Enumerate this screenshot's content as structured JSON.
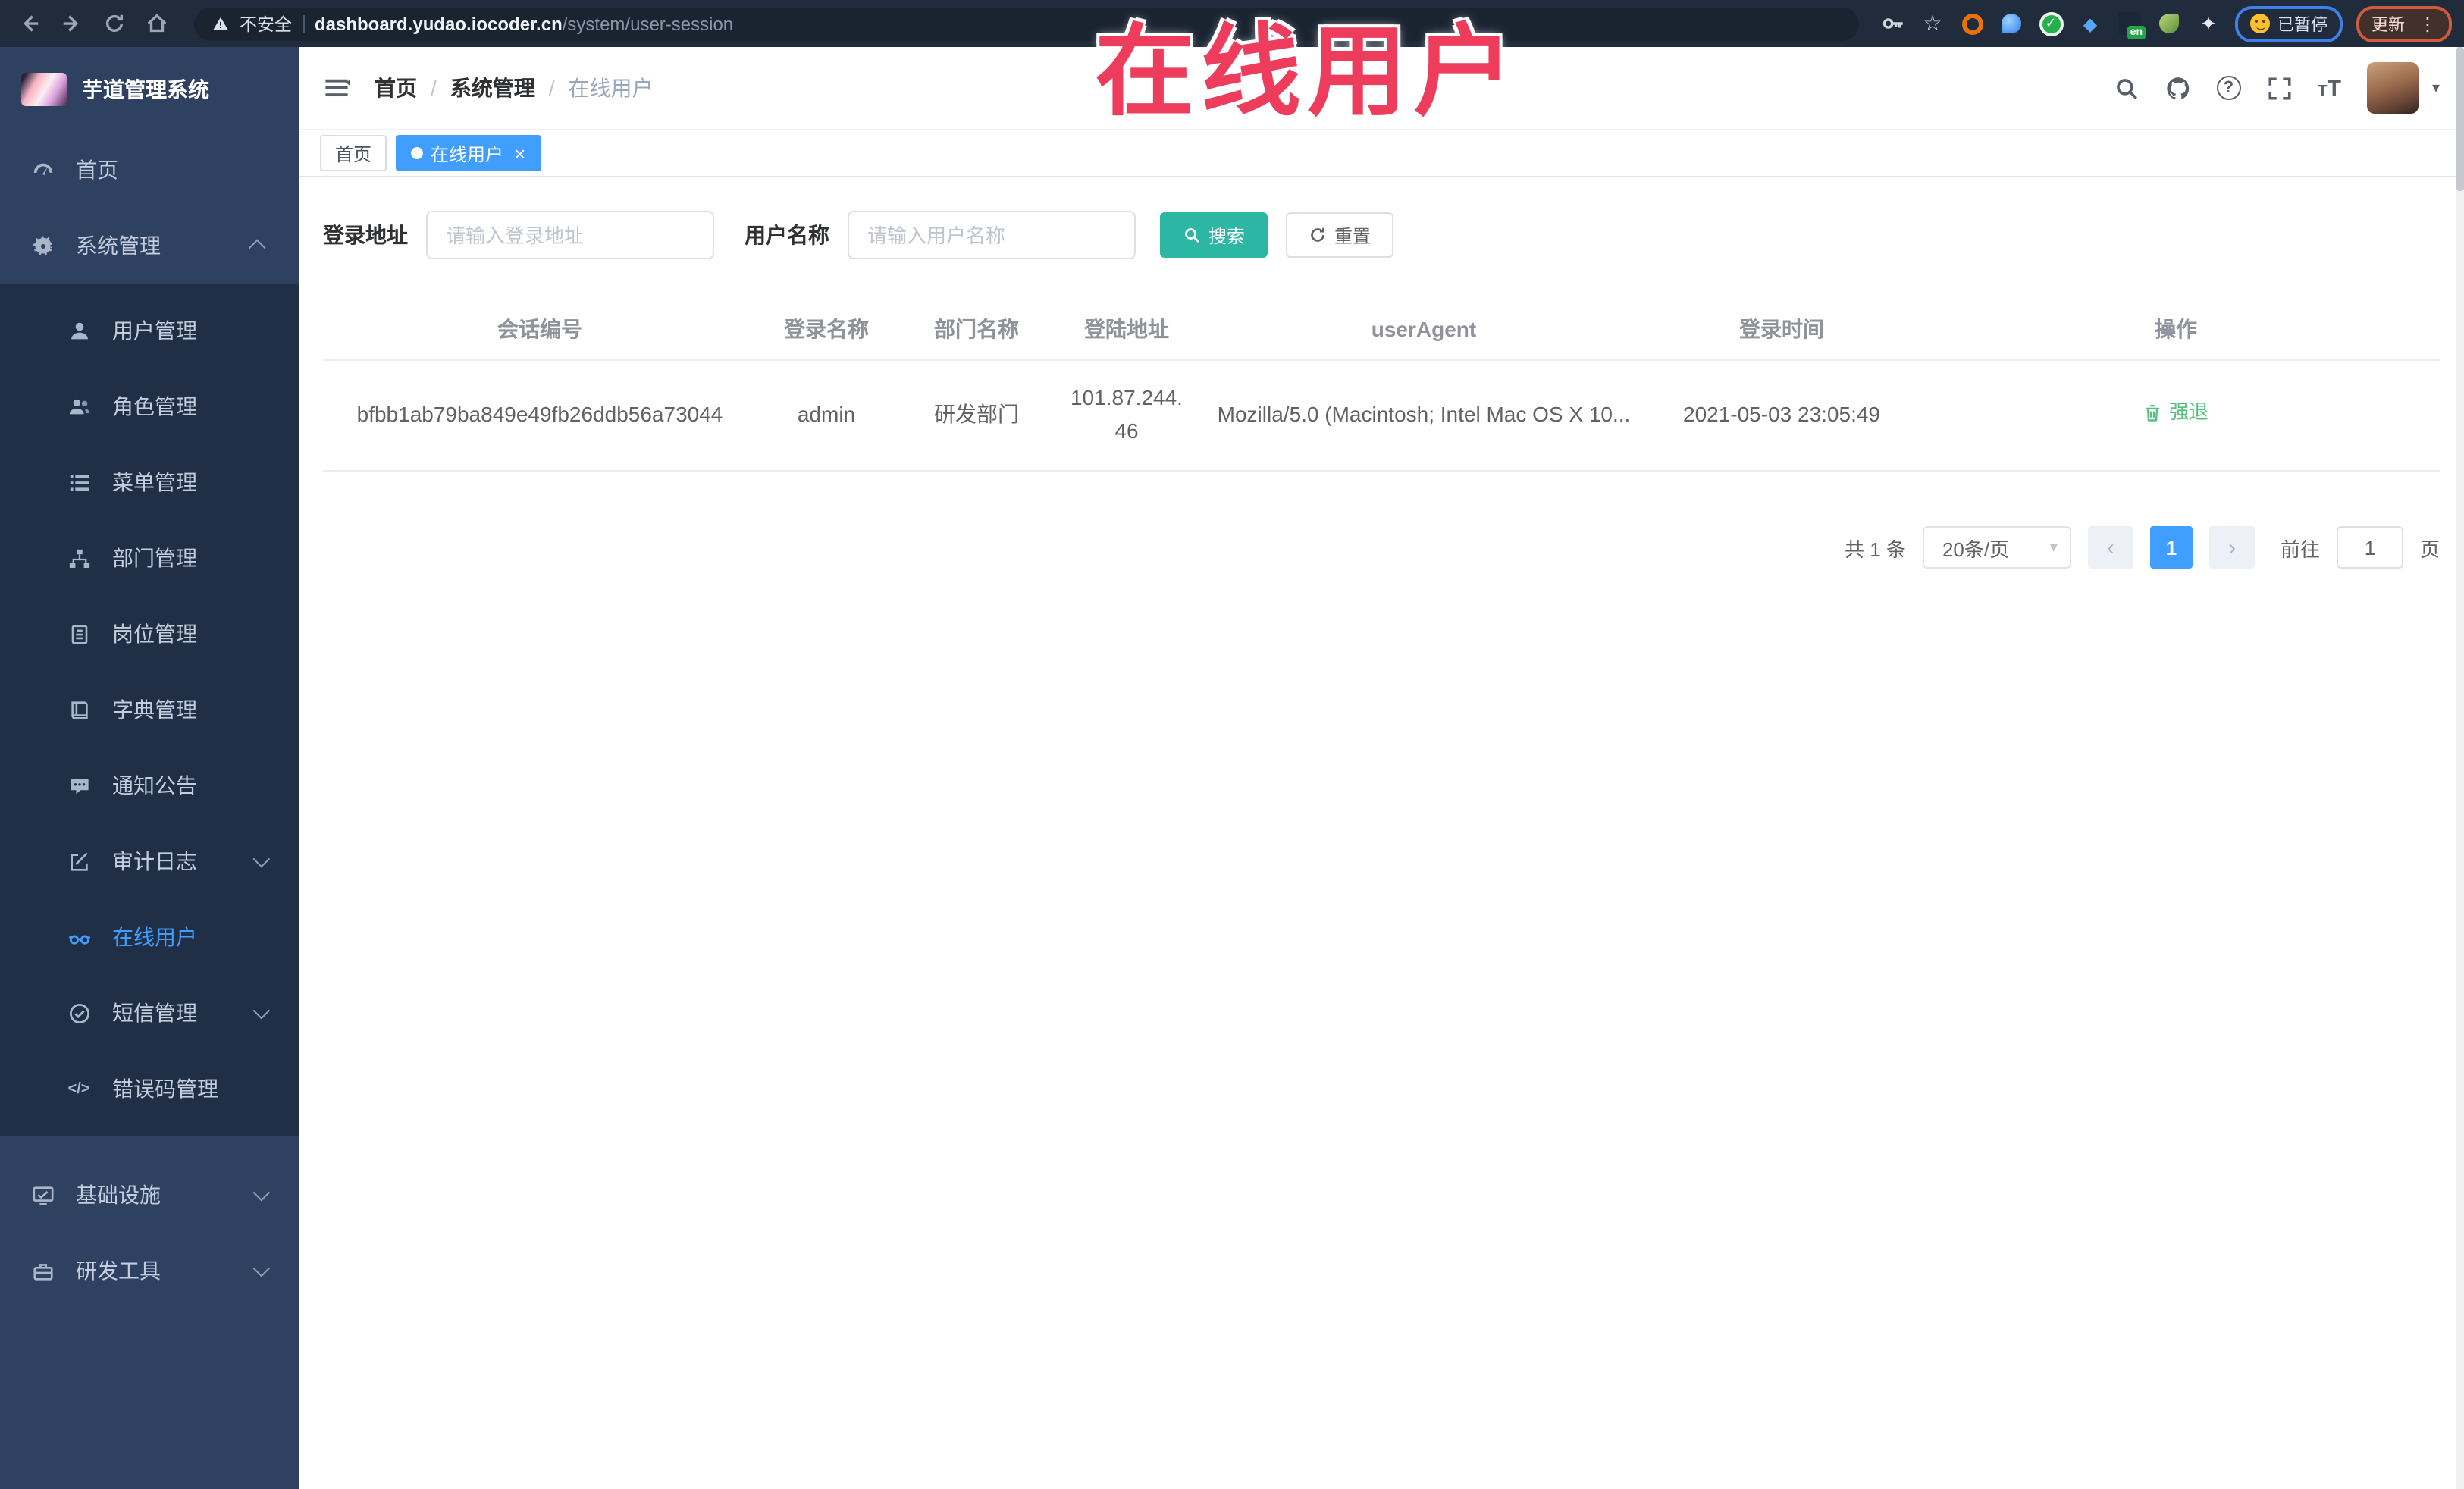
{
  "browser": {
    "security_label": "不安全",
    "url_host": "dashboard.yudao.iocoder.cn",
    "url_path": "/system/user-session",
    "ext_en_badge": "en",
    "paused_label": "已暂停",
    "update_label": "更新",
    "menu_dots": "⋮"
  },
  "overlay": {
    "title": "在线用户"
  },
  "sidebar": {
    "app_title": "芋道管理系统",
    "home": "首页",
    "system": "系统管理",
    "sub": [
      "用户管理",
      "角色管理",
      "菜单管理",
      "部门管理",
      "岗位管理",
      "字典管理",
      "通知公告",
      "审计日志",
      "在线用户",
      "短信管理",
      "错误码管理"
    ],
    "infra": "基础设施",
    "devtools": "研发工具"
  },
  "breadcrumb": {
    "items": [
      "首页",
      "系统管理",
      "在线用户"
    ],
    "separator": "/"
  },
  "tags": {
    "home": "首页",
    "active": "在线用户",
    "close": "×"
  },
  "header_icons": {
    "caret": "▾",
    "font_size_big": "T",
    "font_size_small": "T",
    "question": "?"
  },
  "search": {
    "address_label": "登录地址",
    "address_placeholder": "请输入登录地址",
    "name_label": "用户名称",
    "name_placeholder": "请输入用户名称",
    "search_btn": "搜索",
    "reset_btn": "重置"
  },
  "table": {
    "headers": [
      "会话编号",
      "登录名称",
      "部门名称",
      "登陆地址",
      "userAgent",
      "登录时间",
      "操作"
    ],
    "row": {
      "session_id": "bfbb1ab79ba849e49fb26ddb56a73044",
      "username": "admin",
      "dept": "研发部门",
      "ip": "101.87.244.46",
      "user_agent": "Mozilla/5.0 (Macintosh; Intel Mac OS X 10...",
      "login_time": "2021-05-03 23:05:49",
      "action": "强退"
    }
  },
  "pagination": {
    "total": "共 1 条",
    "page_size": "20条/页",
    "select_caret": "▾",
    "prev": "‹",
    "next": "›",
    "page": "1",
    "goto": "前往",
    "goto_value": "1",
    "unit": "页"
  },
  "glyphs": {
    "ext_diamond": "◆",
    "ext_puzzle": "✦",
    "ext_star": "☆",
    "code_icon": "</>"
  },
  "colors": {
    "accent_blue": "#409eff",
    "search_teal": "#2bb7a3",
    "overlay_red": "#ee3c5c",
    "action_green": "#53c07c",
    "sidebar_bg": "#2e4160",
    "submenu_bg": "#202e46"
  }
}
